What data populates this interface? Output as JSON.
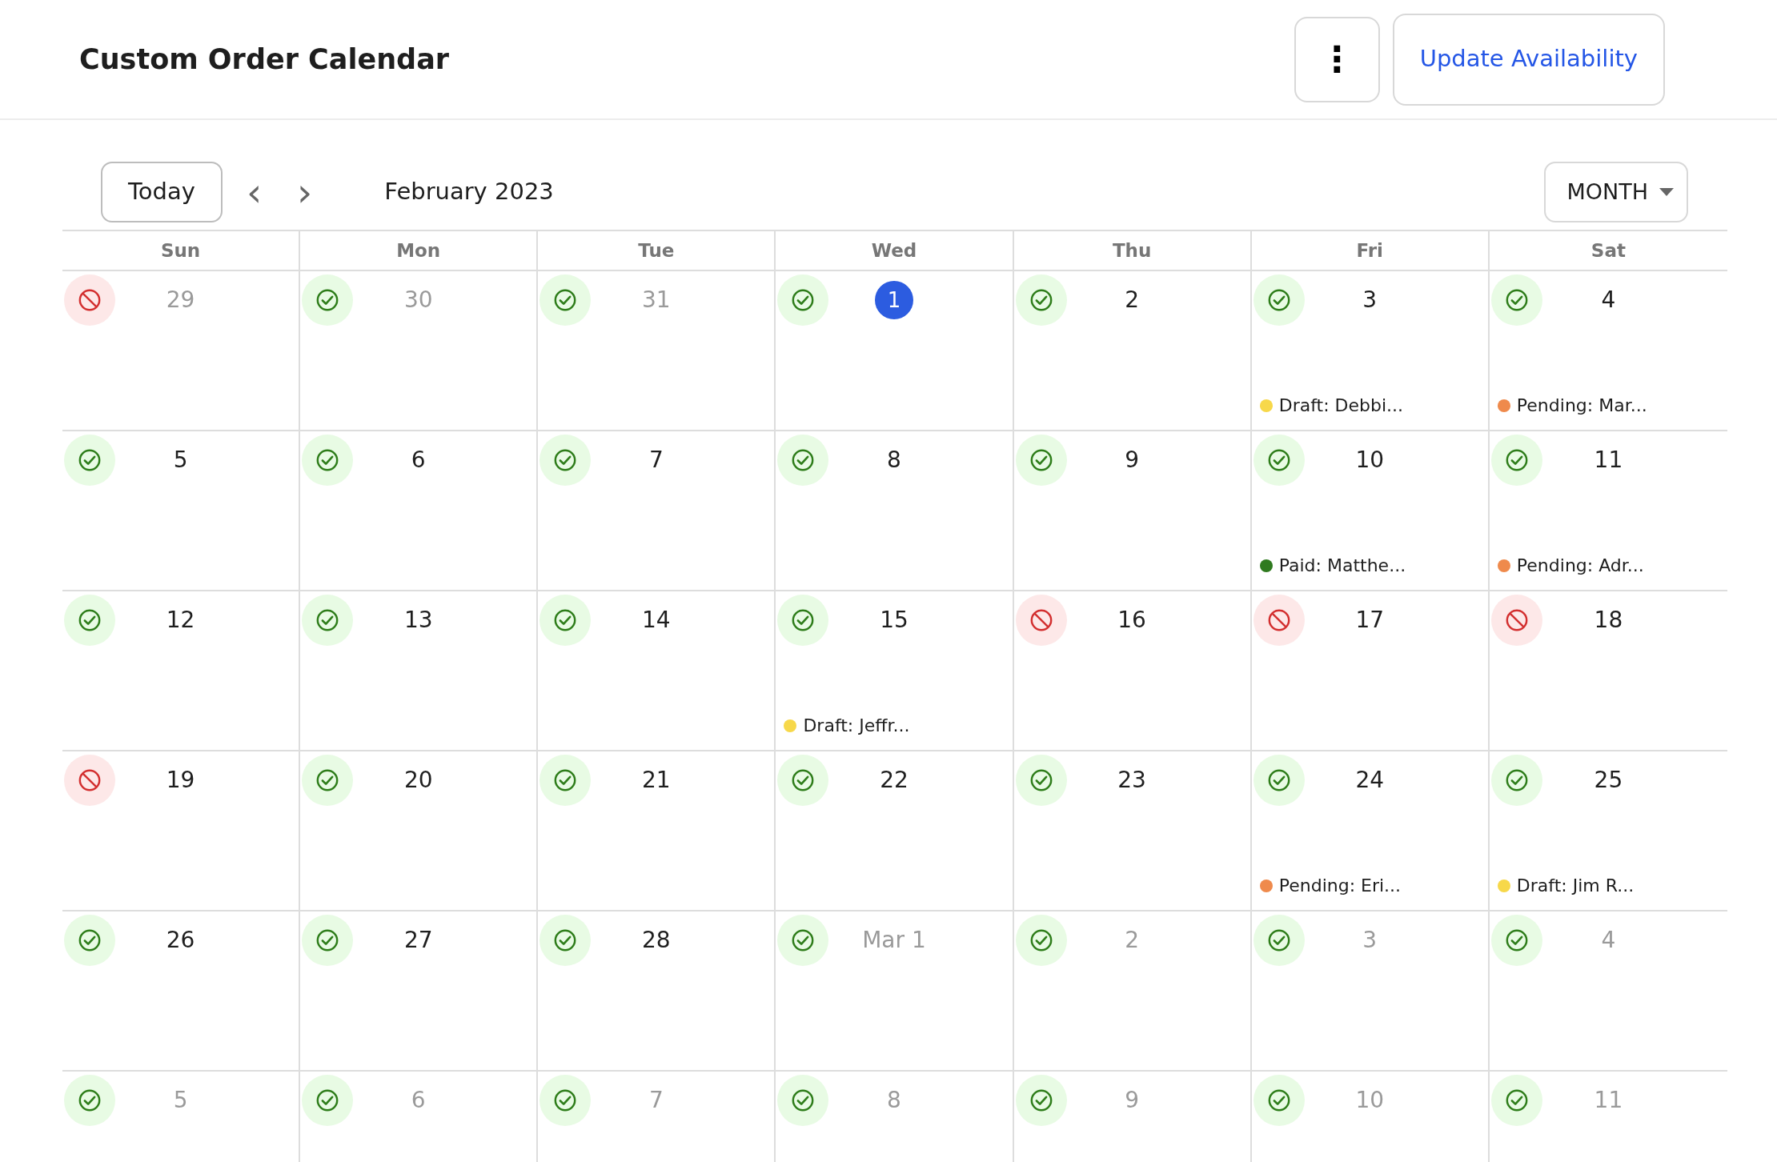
{
  "header": {
    "title": "Custom Order Calendar",
    "more_button": "⋮",
    "primary_button": "Update Availability"
  },
  "toolbar": {
    "today_button": "Today",
    "prev": "‹",
    "next": "›",
    "month_label": "February 2023",
    "view_select": "MONTH"
  },
  "weekdays": [
    "Sun",
    "Mon",
    "Tue",
    "Wed",
    "Thu",
    "Fri",
    "Sat"
  ],
  "weeks": [
    [
      {
        "date": "29",
        "outside_month": true,
        "today": false,
        "available": false
      },
      {
        "date": "30",
        "outside_month": true,
        "today": false,
        "available": true
      },
      {
        "date": "31",
        "outside_month": true,
        "today": false,
        "available": true
      },
      {
        "date": "1",
        "outside_month": false,
        "today": true,
        "available": true
      },
      {
        "date": "2",
        "outside_month": false,
        "today": false,
        "available": true
      },
      {
        "date": "3",
        "outside_month": false,
        "today": false,
        "available": true,
        "events": [
          {
            "label": "Draft: Debbi...",
            "color": "#f7d84a"
          }
        ]
      },
      {
        "date": "4",
        "outside_month": false,
        "today": false,
        "available": true,
        "events": [
          {
            "label": "Pending: Mar...",
            "color": "#ef8a4c"
          }
        ]
      }
    ],
    [
      {
        "date": "5",
        "outside_month": false,
        "today": false,
        "available": true
      },
      {
        "date": "6",
        "outside_month": false,
        "today": false,
        "available": true
      },
      {
        "date": "7",
        "outside_month": false,
        "today": false,
        "available": true
      },
      {
        "date": "8",
        "outside_month": false,
        "today": false,
        "available": true
      },
      {
        "date": "9",
        "outside_month": false,
        "today": false,
        "available": true
      },
      {
        "date": "10",
        "outside_month": false,
        "today": false,
        "available": true,
        "events": [
          {
            "label": "Paid: Matthe...",
            "color": "#2f7a1f"
          }
        ]
      },
      {
        "date": "11",
        "outside_month": false,
        "today": false,
        "available": true,
        "events": [
          {
            "label": "Pending: Adr...",
            "color": "#ef8a4c"
          }
        ]
      }
    ],
    [
      {
        "date": "12",
        "outside_month": false,
        "today": false,
        "available": true
      },
      {
        "date": "13",
        "outside_month": false,
        "today": false,
        "available": true
      },
      {
        "date": "14",
        "outside_month": false,
        "today": false,
        "available": true
      },
      {
        "date": "15",
        "outside_month": false,
        "today": false,
        "available": true,
        "events": [
          {
            "label": "Draft: Jeffr...",
            "color": "#f7d84a"
          }
        ]
      },
      {
        "date": "16",
        "outside_month": false,
        "today": false,
        "available": false
      },
      {
        "date": "17",
        "outside_month": false,
        "today": false,
        "available": false
      },
      {
        "date": "18",
        "outside_month": false,
        "today": false,
        "available": false
      }
    ],
    [
      {
        "date": "19",
        "outside_month": false,
        "today": false,
        "available": false
      },
      {
        "date": "20",
        "outside_month": false,
        "today": false,
        "available": true
      },
      {
        "date": "21",
        "outside_month": false,
        "today": false,
        "available": true
      },
      {
        "date": "22",
        "outside_month": false,
        "today": false,
        "available": true
      },
      {
        "date": "23",
        "outside_month": false,
        "today": false,
        "available": true
      },
      {
        "date": "24",
        "outside_month": false,
        "today": false,
        "available": true,
        "events": [
          {
            "label": "Pending: Eri...",
            "color": "#ef8a4c"
          }
        ]
      },
      {
        "date": "25",
        "outside_month": false,
        "today": false,
        "available": true,
        "events": [
          {
            "label": "Draft: Jim R...",
            "color": "#f7d84a"
          }
        ]
      }
    ],
    [
      {
        "date": "26",
        "outside_month": false,
        "today": false,
        "available": true
      },
      {
        "date": "27",
        "outside_month": false,
        "today": false,
        "available": true
      },
      {
        "date": "28",
        "outside_month": false,
        "today": false,
        "available": true
      },
      {
        "date": "Mar 1",
        "outside_month": true,
        "today": false,
        "available": true
      },
      {
        "date": "2",
        "outside_month": true,
        "today": false,
        "available": true
      },
      {
        "date": "3",
        "outside_month": true,
        "today": false,
        "available": true
      },
      {
        "date": "4",
        "outside_month": true,
        "today": false,
        "available": true
      }
    ],
    [
      {
        "date": "5",
        "outside_month": true,
        "today": false,
        "available": true
      },
      {
        "date": "6",
        "outside_month": true,
        "today": false,
        "available": true
      },
      {
        "date": "7",
        "outside_month": true,
        "today": false,
        "available": true
      },
      {
        "date": "8",
        "outside_month": true,
        "today": false,
        "available": true
      },
      {
        "date": "9",
        "outside_month": true,
        "today": false,
        "available": true
      },
      {
        "date": "10",
        "outside_month": true,
        "today": false,
        "available": true
      },
      {
        "date": "11",
        "outside_month": true,
        "today": false,
        "available": true
      }
    ]
  ]
}
